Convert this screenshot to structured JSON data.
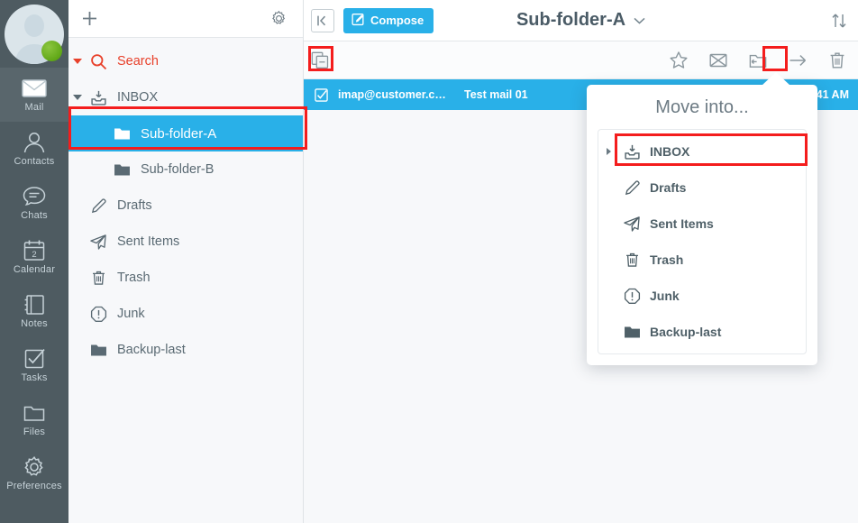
{
  "rail": {
    "avatar": {
      "name": "user-avatar",
      "presence": "online",
      "presence_color": "#6aa81e"
    },
    "items": [
      {
        "label": "Mail",
        "icon": "mail-icon",
        "active": true
      },
      {
        "label": "Contacts",
        "icon": "contacts-icon",
        "active": false
      },
      {
        "label": "Chats",
        "icon": "chats-icon",
        "active": false
      },
      {
        "label": "Calendar",
        "icon": "calendar-icon",
        "active": false,
        "day": "2"
      },
      {
        "label": "Notes",
        "icon": "notes-icon",
        "active": false
      },
      {
        "label": "Tasks",
        "icon": "tasks-icon",
        "active": false
      },
      {
        "label": "Files",
        "icon": "files-icon",
        "active": false
      },
      {
        "label": "Preferences",
        "icon": "gear-icon",
        "active": false
      }
    ]
  },
  "folder_pane": {
    "add_icon": "plus-icon",
    "settings_icon": "gear-icon",
    "items": [
      {
        "label": "Search",
        "icon": "search-icon",
        "caret": true,
        "level": 0,
        "selected": false,
        "accent": "#e8402a"
      },
      {
        "label": "INBOX",
        "icon": "inbox-icon",
        "caret": true,
        "level": 0,
        "selected": false
      },
      {
        "label": "Sub-folder-A",
        "icon": "folder-icon",
        "caret": false,
        "level": 1,
        "selected": true
      },
      {
        "label": "Sub-folder-B",
        "icon": "folder-icon",
        "caret": false,
        "level": 1,
        "selected": false
      },
      {
        "label": "Drafts",
        "icon": "pencil-icon",
        "caret": false,
        "level": 0,
        "selected": false
      },
      {
        "label": "Sent Items",
        "icon": "paper-plane-icon",
        "caret": false,
        "level": 0,
        "selected": false
      },
      {
        "label": "Trash",
        "icon": "trash-icon",
        "caret": false,
        "level": 0,
        "selected": false
      },
      {
        "label": "Junk",
        "icon": "junk-icon",
        "caret": false,
        "level": 0,
        "selected": false
      },
      {
        "label": "Backup-last",
        "icon": "folder-icon",
        "caret": false,
        "level": 0,
        "selected": false
      }
    ]
  },
  "toolbar": {
    "back_icon": "back-arrow-icon",
    "compose_label": "Compose",
    "compose_icon": "compose-pencil-icon",
    "title": "Sub-folder-A",
    "title_chevron": "⌄",
    "sort_icon": "sort-updown-icon"
  },
  "action_bar": {
    "select_all_icon": "multi-select-icon",
    "actions": [
      {
        "icon": "star-icon",
        "name": "flag-button",
        "highlighted": false
      },
      {
        "icon": "envelope-unread-icon",
        "name": "mark-unread-button",
        "highlighted": false
      },
      {
        "icon": "move-to-folder-icon",
        "name": "move-to-folder-button",
        "highlighted": true
      },
      {
        "icon": "arrow-right-icon",
        "name": "forward-button",
        "highlighted": false
      },
      {
        "icon": "trash-icon",
        "name": "delete-button",
        "highlighted": false
      }
    ]
  },
  "mail_list": {
    "rows": [
      {
        "checkbox_icon": "checkbox-checked-icon",
        "sender": "imap@customer.c…",
        "subject": "Test mail 01",
        "time": "0:41 AM",
        "selected": true
      }
    ]
  },
  "popup": {
    "title": "Move into...",
    "items": [
      {
        "label": "INBOX",
        "icon": "inbox-icon",
        "has_children": true,
        "highlighted": true
      },
      {
        "label": "Drafts",
        "icon": "pencil-icon",
        "has_children": false,
        "highlighted": false
      },
      {
        "label": "Sent Items",
        "icon": "paper-plane-icon",
        "has_children": false,
        "highlighted": false
      },
      {
        "label": "Trash",
        "icon": "trash-icon",
        "has_children": false,
        "highlighted": false
      },
      {
        "label": "Junk",
        "icon": "junk-icon",
        "has_children": false,
        "highlighted": false
      },
      {
        "label": "Backup-last",
        "icon": "folder-icon",
        "has_children": false,
        "highlighted": false
      }
    ]
  },
  "colors": {
    "accent_blue": "#29b0e8",
    "highlight_red": "#f41d1d",
    "rail_bg": "#4e5b61",
    "pane_bg": "#f7f8fa",
    "text_gray": "#5a6a73"
  }
}
